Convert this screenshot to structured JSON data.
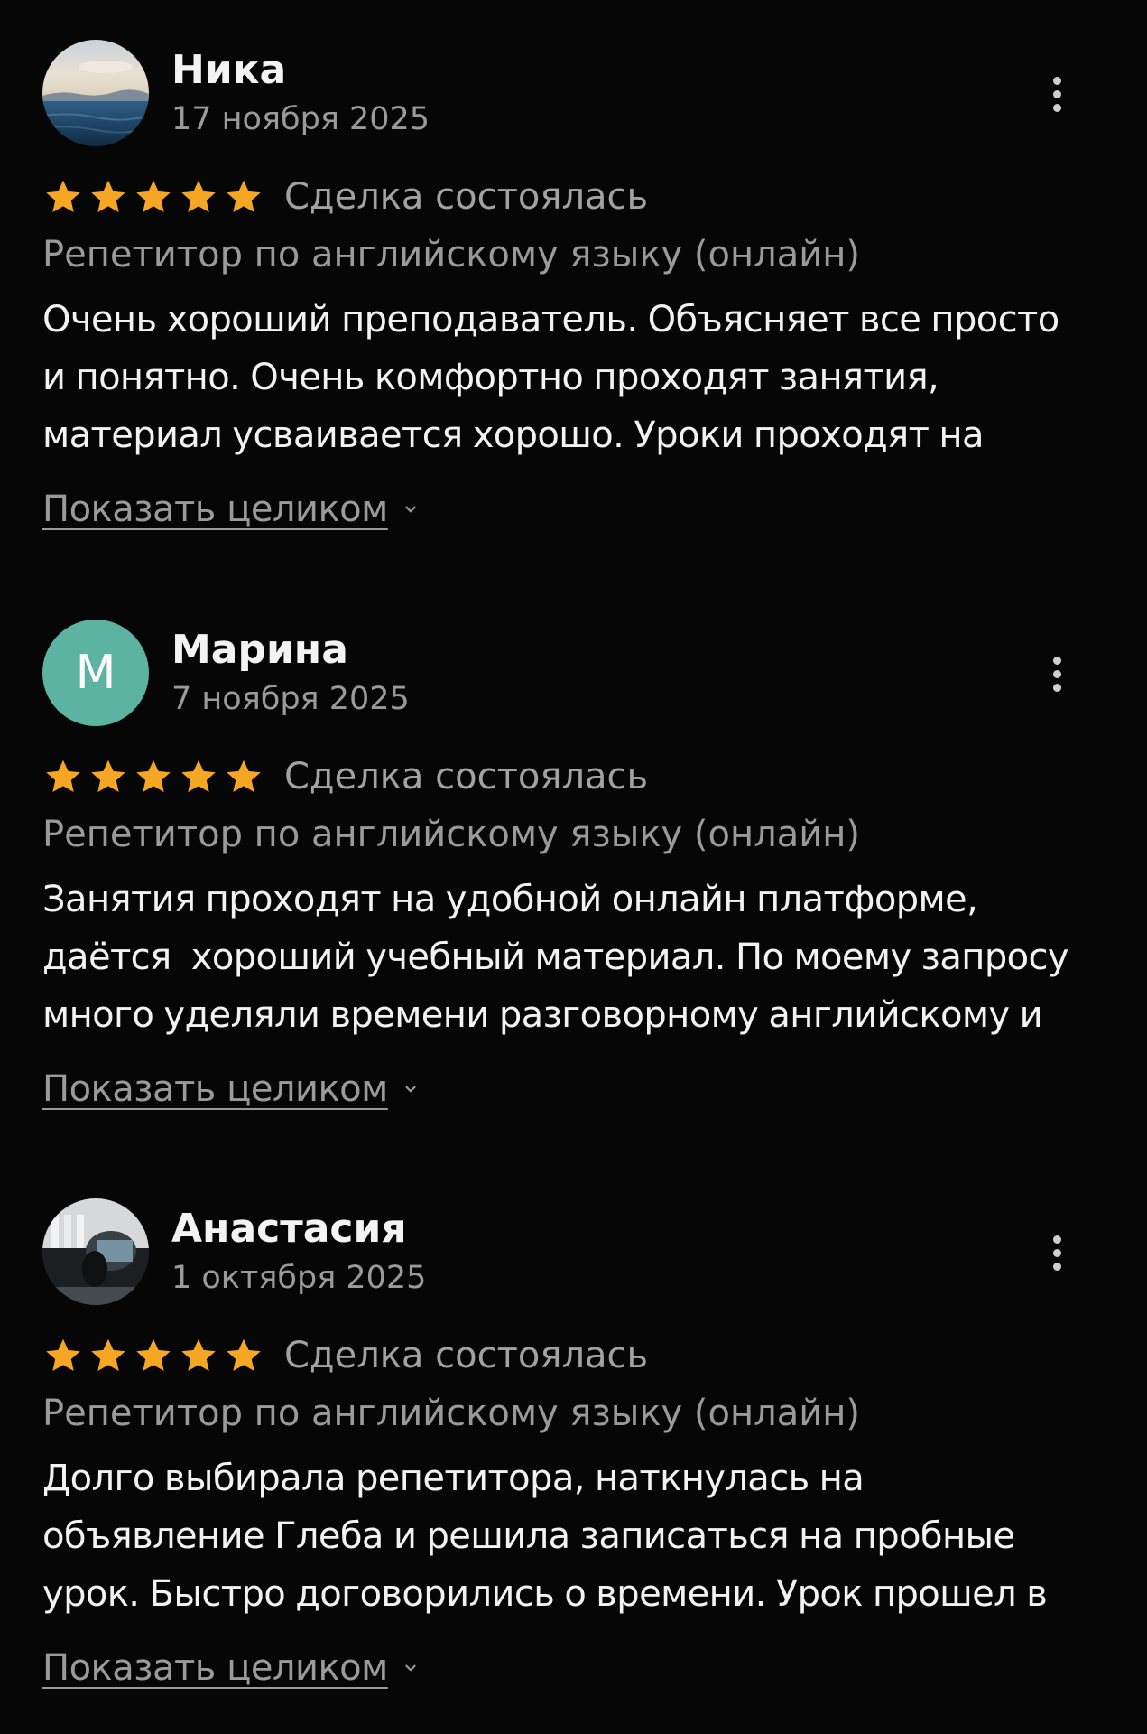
{
  "colors": {
    "background": "#060606",
    "star": "#f5a623",
    "text_primary": "#f2f2f2",
    "text_secondary": "#9a9a9a",
    "avatar_marina": "#5db3a2"
  },
  "reviews": [
    {
      "name": "Ника",
      "date": "17 ноября 2025",
      "avatar": {
        "type": "photo",
        "description_icon": "sea-photo"
      },
      "rating": 5,
      "deal_status": "Сделка состоялась",
      "service": "Репетитор по английскому языку (онлайн)",
      "text_lines": [
        "Очень хороший преподаватель. Объясняет все просто",
        "и понятно. Очень комфортно проходят занятия,",
        "материал усваивается хорошо. Уроки проходят на"
      ],
      "show_more": "Показать целиком"
    },
    {
      "name": "Марина",
      "date": "7 ноября 2025",
      "avatar": {
        "type": "letter",
        "letter": "М"
      },
      "rating": 5,
      "deal_status": "Сделка состоялась",
      "service": "Репетитор по английскому языку (онлайн)",
      "text_lines": [
        "Занятия проходят на удобной онлайн платформе,",
        "даётся  хороший учебный материал. По моему запросу",
        "много уделяли времени разговорному английскому и"
      ],
      "show_more": "Показать целиком"
    },
    {
      "name": "Анастасия",
      "date": "1 октября 2025",
      "avatar": {
        "type": "photo",
        "description_icon": "room-photo"
      },
      "rating": 5,
      "deal_status": "Сделка состоялась",
      "service": "Репетитор по английскому языку (онлайн)",
      "text_lines": [
        "Долго выбирала репетитора, наткнулась на",
        "объявление Глеба и решила записаться на пробные",
        "урок. Быстро договорились о времени. Урок прошел в"
      ],
      "show_more": "Показать целиком"
    }
  ]
}
